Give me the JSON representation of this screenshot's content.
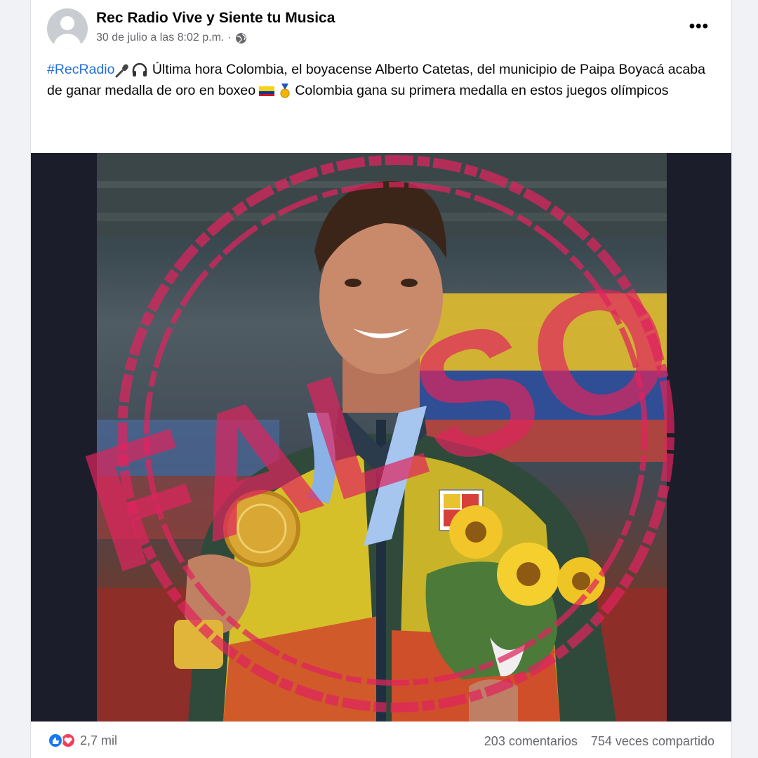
{
  "post": {
    "page_name": "Rec Radio Vive y Siente tu Musica",
    "timestamp": "30 de julio a las 8:02 p.m.",
    "separator": "·",
    "more_label": "•••",
    "hashtag": "#RecRadio",
    "text_part1": " Última hora Colombia, el boyacense Alberto Catetas, del municipio de Paipa Boyacá acaba de ganar medalla de oro en boxeo",
    "text_part2": " Colombia gana su primera medalla en estos juegos olímpicos",
    "icons": [
      "globe-icon",
      "microphone-icon",
      "headphones-icon",
      "colombia-flag-icon",
      "medal-icon",
      "like-reaction-icon",
      "love-reaction-icon",
      "more-options-icon"
    ]
  },
  "image": {
    "stamp_text": "FALSO",
    "stamp_color": "#e0245e",
    "flag_colors": [
      "#fcd116",
      "#003893",
      "#ce1126"
    ]
  },
  "footer": {
    "reaction_count": "2,7 mil",
    "comments": "203 comentarios",
    "shares": "754 veces compartido"
  }
}
